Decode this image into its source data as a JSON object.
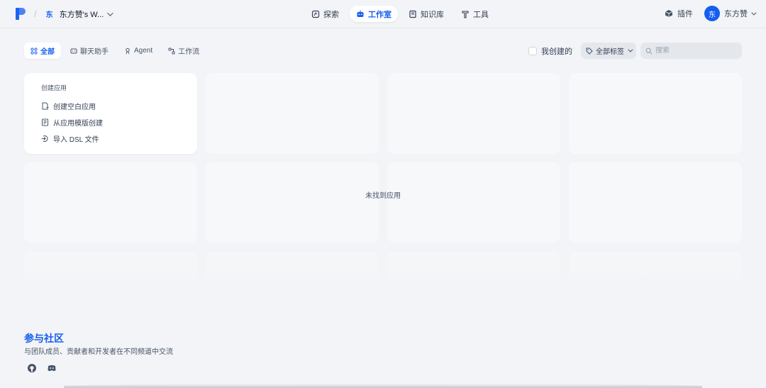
{
  "header": {
    "workspace_initial": "东",
    "workspace_name": "东方赞's W...",
    "nav": [
      {
        "label": "探索",
        "icon": "explore-icon"
      },
      {
        "label": "工作室",
        "icon": "robot-icon"
      },
      {
        "label": "知识库",
        "icon": "book-icon"
      },
      {
        "label": "工具",
        "icon": "tool-icon"
      }
    ],
    "plugin_label": "插件",
    "user_initial": "东",
    "user_name": "东方赞"
  },
  "tabs": [
    {
      "label": "全部",
      "icon": "grid-icon"
    },
    {
      "label": "聊天助手",
      "icon": "chat-icon"
    },
    {
      "label": "Agent",
      "icon": "agent-icon"
    },
    {
      "label": "工作流",
      "icon": "workflow-icon"
    }
  ],
  "filters": {
    "created_by_me": "我创建的",
    "tags_label": "全部标签",
    "search_placeholder": "搜索"
  },
  "create": {
    "title": "创建应用",
    "items": [
      {
        "label": "创建空白应用",
        "icon": "file-plus-icon"
      },
      {
        "label": "从应用模版创建",
        "icon": "template-icon"
      },
      {
        "label": "导入 DSL 文件",
        "icon": "import-icon"
      }
    ]
  },
  "empty_text": "未找到应用",
  "community": {
    "title": "参与社区",
    "description": "与团队成员、贡献者和开发者在不同频道中交流"
  },
  "colors": {
    "accent": "#155eef",
    "background": "#f2f4f7"
  }
}
